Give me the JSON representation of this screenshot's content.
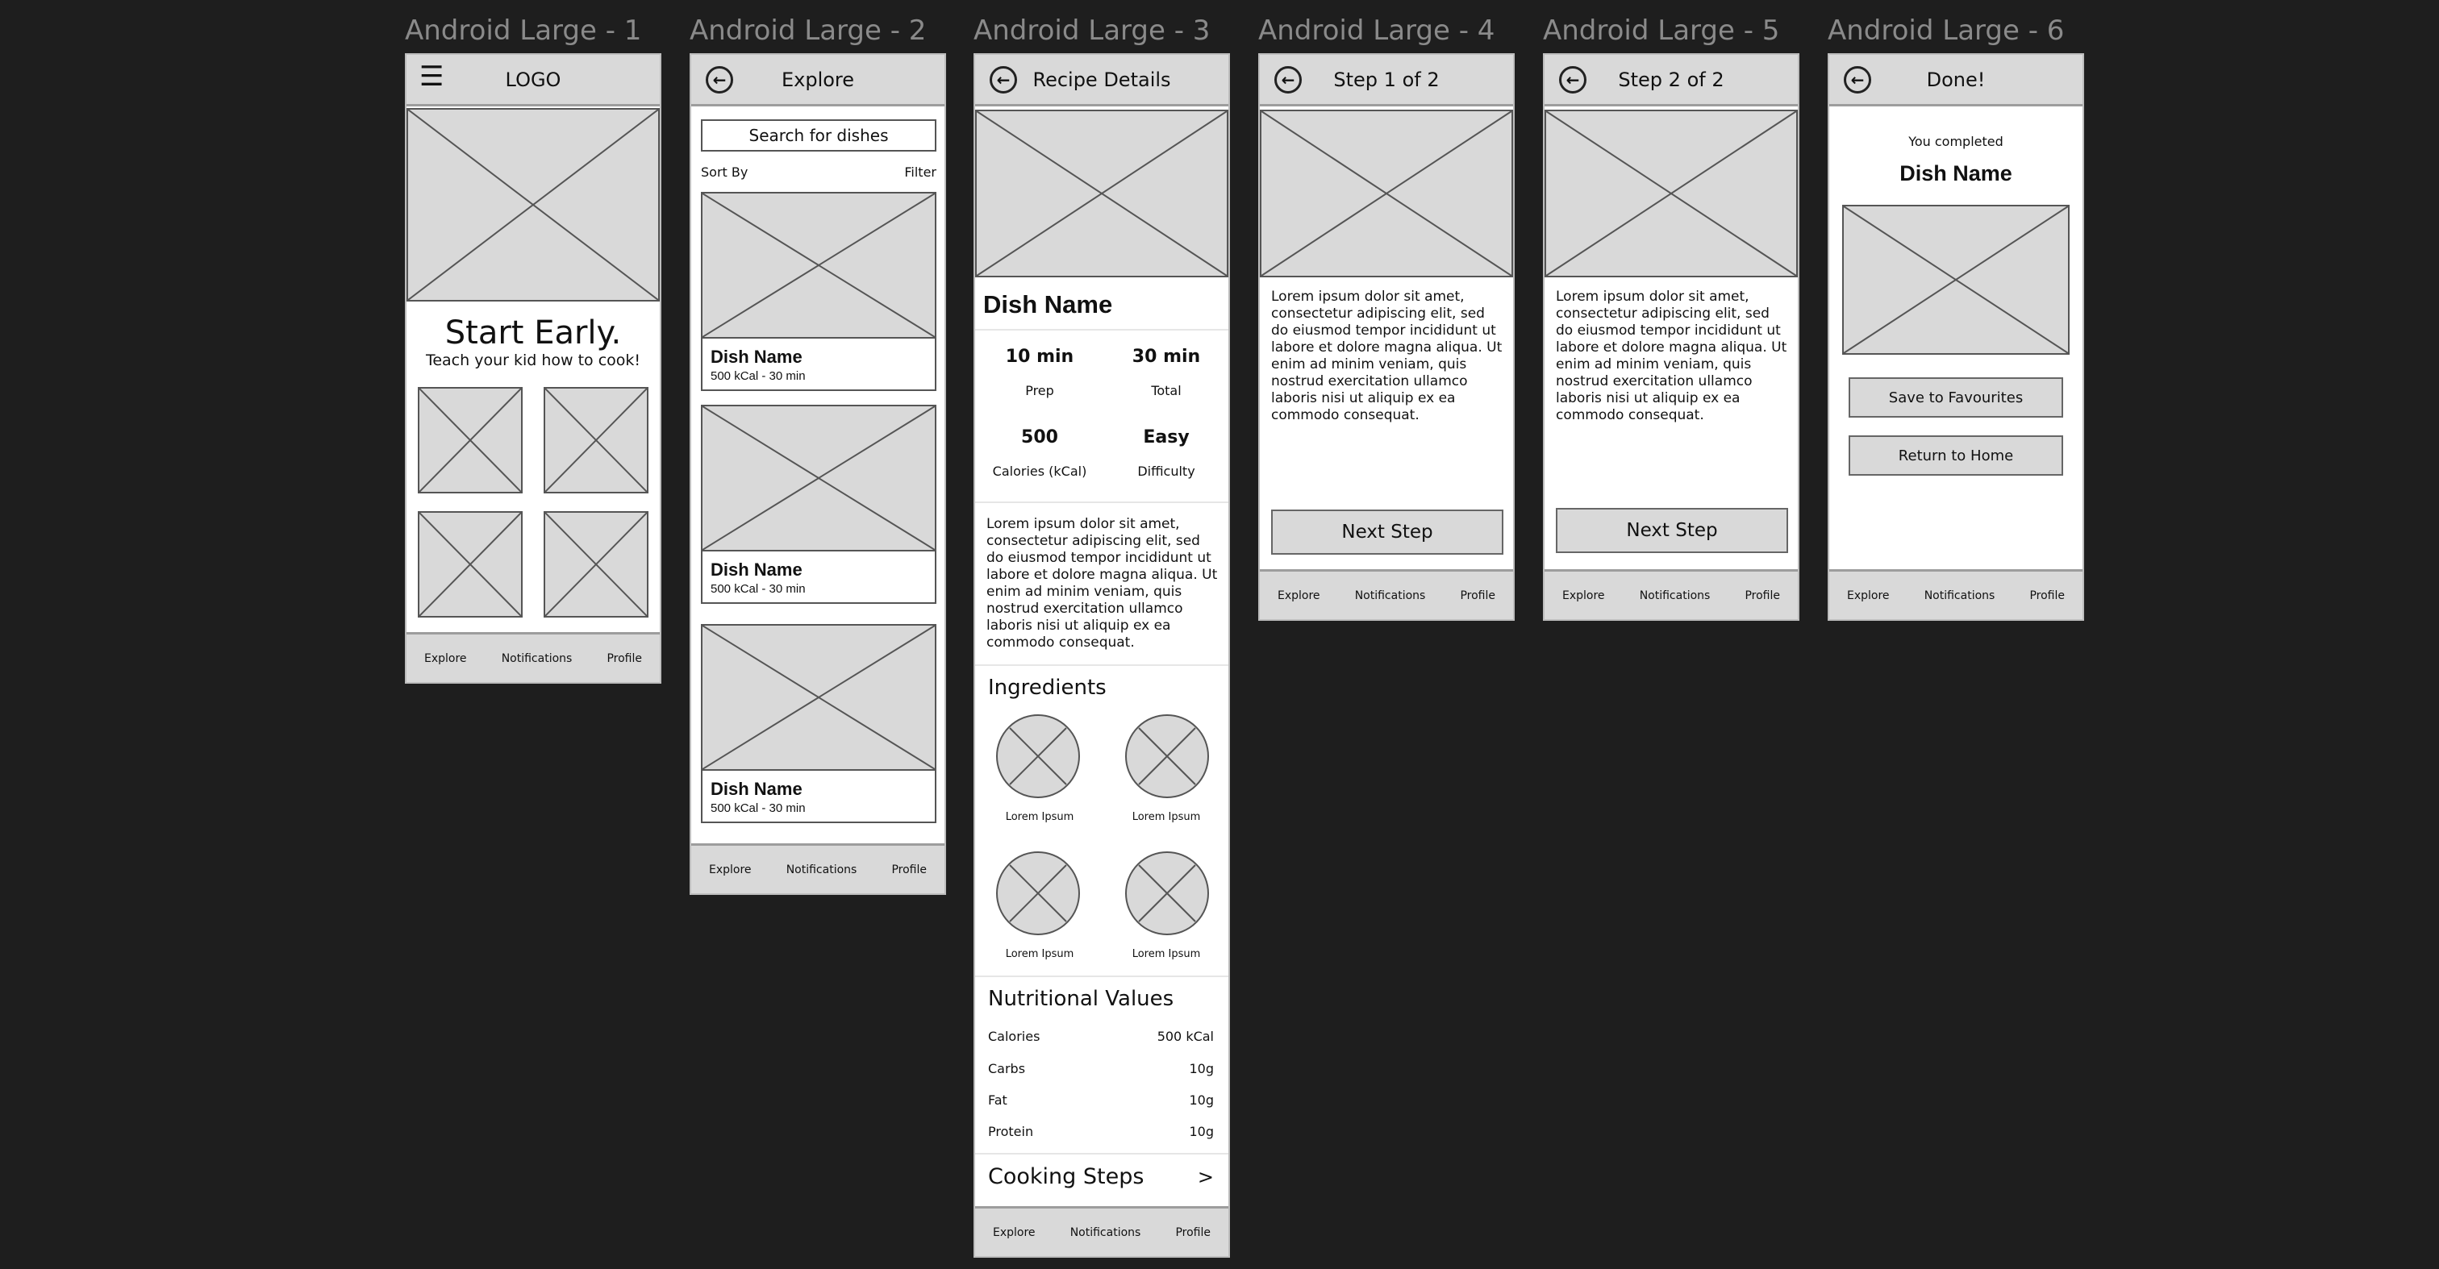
{
  "frames": [
    {
      "label": "Android Large - 1"
    },
    {
      "label": "Android Large - 2"
    },
    {
      "label": "Android Large - 3"
    },
    {
      "label": "Android Large - 4"
    },
    {
      "label": "Android Large - 5"
    },
    {
      "label": "Android Large - 6"
    }
  ],
  "nav": {
    "explore": "Explore",
    "notifications": "Notifications",
    "profile": "Profile"
  },
  "s1": {
    "logo": "LOGO",
    "headline": "Start Early.",
    "subline": "Teach your kid how to cook!"
  },
  "s2": {
    "title": "Explore",
    "search_placeholder": "Search for dishes",
    "sort": "Sort By",
    "filter": "Filter",
    "cards": [
      {
        "name": "Dish Name",
        "meta": "500 kCal - 30 min"
      },
      {
        "name": "Dish Name",
        "meta": "500 kCal - 30 min"
      },
      {
        "name": "Dish Name",
        "meta": "500 kCal - 30 min"
      }
    ]
  },
  "s3": {
    "title": "Recipe Details",
    "dish": "Dish Name",
    "stats": [
      {
        "value": "10 min",
        "label": "Prep"
      },
      {
        "value": "30 min",
        "label": "Total"
      },
      {
        "value": "500",
        "label": "Calories (kCal)"
      },
      {
        "value": "Easy",
        "label": "Difficulty"
      }
    ],
    "desc": "Lorem ipsum dolor sit amet, consectetur adipiscing elit, sed do eiusmod tempor incididunt ut labore et dolore magna aliqua. Ut enim ad minim veniam, quis nostrud exercitation ullamco laboris nisi ut aliquip ex ea commodo consequat.",
    "ingredients_title": "Ingredients",
    "ingredients": [
      "Lorem Ipsum",
      "Lorem Ipsum",
      "Lorem Ipsum",
      "Lorem Ipsum"
    ],
    "nutrition_title": "Nutritional Values",
    "nutrition": [
      {
        "name": "Calories",
        "value": "500 kCal"
      },
      {
        "name": "Carbs",
        "value": "10g"
      },
      {
        "name": "Fat",
        "value": "10g"
      },
      {
        "name": "Protein",
        "value": "10g"
      }
    ],
    "steps_title": "Cooking Steps",
    "steps_arrow": ">"
  },
  "s4": {
    "title": "Step 1 of 2",
    "text": "Lorem ipsum dolor sit amet, consectetur adipiscing elit, sed do eiusmod tempor incididunt ut labore et dolore magna aliqua. Ut enim ad minim veniam, quis nostrud exercitation ullamco laboris nisi ut aliquip ex ea commodo consequat.",
    "button": "Next Step"
  },
  "s5": {
    "title": "Step 2 of 2",
    "text": "Lorem ipsum dolor sit amet, consectetur adipiscing elit, sed do eiusmod tempor incididunt ut labore et dolore magna aliqua. Ut enim ad minim veniam, quis nostrud exercitation ullamco laboris nisi ut aliquip ex ea commodo consequat.",
    "button": "Next Step"
  },
  "s6": {
    "title": "Done!",
    "completed": "You completed",
    "dish": "Dish Name",
    "save": "Save to Favourites",
    "home": "Return to Home"
  },
  "icons": {
    "back": "back-arrow-icon",
    "menu": "hamburger-menu-icon",
    "placeholder": "image-placeholder-icon"
  }
}
